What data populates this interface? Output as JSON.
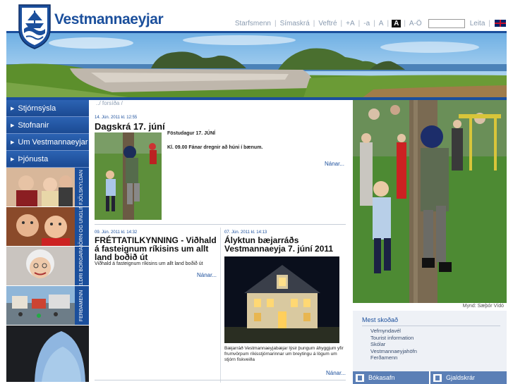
{
  "header": {
    "brand": "Vestmannaeyjar",
    "links": [
      "Starfsmenn",
      "Símaskrá",
      "Veftré",
      "+A",
      "-a",
      "A",
      "A",
      "A-Ö"
    ],
    "search_button": "Leita",
    "search_placeholder": ""
  },
  "breadcrumb": "../ forsíða /",
  "nav": {
    "items": [
      {
        "label": "Stjórnsýsla"
      },
      {
        "label": "Stofnanir"
      },
      {
        "label": "Um Vestmannaeyjar"
      },
      {
        "label": "Þjónusta"
      }
    ],
    "tiles": [
      {
        "label": "FJÖLSKYLDAN"
      },
      {
        "label": "BÖRN OG UNGLINGAR"
      },
      {
        "label": "ELDRI BORGARAR"
      },
      {
        "label": "FERÐAMENN"
      }
    ]
  },
  "articles": {
    "a1": {
      "date": "14. Jún. 2011 kl. 12:55",
      "title": "Dagskrá 17. júní",
      "p1": "Föstudagur 17. JÚNÍ",
      "p2": "Kl. 09.00 Fánar dregnir að húni í bænum.",
      "more": "Nánar..."
    },
    "a2": {
      "date": "09. Jún. 2011 kl. 14:32",
      "title": "FRÉTTATILKYNNING - Viðhald á fasteignum ríkisins um allt land boðið út",
      "sub": "Viðhald á fasteignum ríkisins um allt land boðið út",
      "more": "Nánar..."
    },
    "a3": {
      "date": "07. Jún. 2011 kl. 14:13",
      "title": "Ályktun bæjarráðs Vestmannaeyja 7. júní 2011",
      "sub": "Bæjarráð Vestmannaeyjabæjar lýsir þungum áhyggjum yfir frumvörpum ríkisstjórnarinnar um breytingu á lögum um stjórn fiskveiða",
      "more": "Nánar..."
    }
  },
  "right": {
    "caption": "Mynd: Sæþór Vídó",
    "mest_title": "Mest skoðað",
    "mest_items": [
      "Vefmyndavél",
      "Tourist information",
      "Skólar",
      "Vestmannaeyjahöfn",
      "Ferðamenn"
    ],
    "buttons": [
      "Bókasafn",
      "Gjaldskrár"
    ]
  }
}
